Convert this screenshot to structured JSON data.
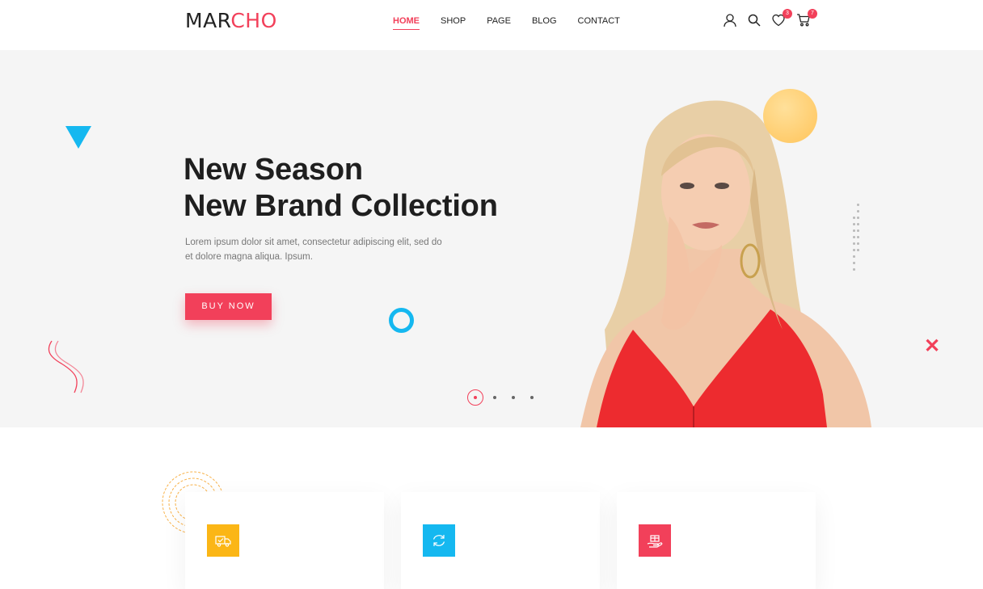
{
  "brand": {
    "part1": "MAR",
    "part2": "CHO",
    "accent": "#f2405a"
  },
  "nav": {
    "items": [
      {
        "label": "HOME",
        "active": true
      },
      {
        "label": "SHOP",
        "active": false
      },
      {
        "label": "PAGE",
        "active": false
      },
      {
        "label": "BLOG",
        "active": false
      },
      {
        "label": "CONTACT",
        "active": false
      }
    ]
  },
  "header_icons": {
    "account": "user-icon",
    "search": "search-icon",
    "wishlist": "heart-icon",
    "wishlist_count": "3",
    "cart": "cart-icon",
    "cart_count": "7"
  },
  "hero": {
    "title_line1": "New Season",
    "title_line2": "New Brand Collection",
    "description": "Lorem ipsum dolor sit amet, consectetur adipiscing elit, sed do et dolore magna aliqua. Ipsum.",
    "button_label": "BUY NOW",
    "slides_total": 4,
    "active_slide": 1
  },
  "features": {
    "cards": [
      {
        "icon": "delivery-truck-icon",
        "color": "#fbb616"
      },
      {
        "icon": "refresh-icon",
        "color": "#15b8f0"
      },
      {
        "icon": "gift-hand-icon",
        "color": "#f2405a"
      }
    ]
  }
}
